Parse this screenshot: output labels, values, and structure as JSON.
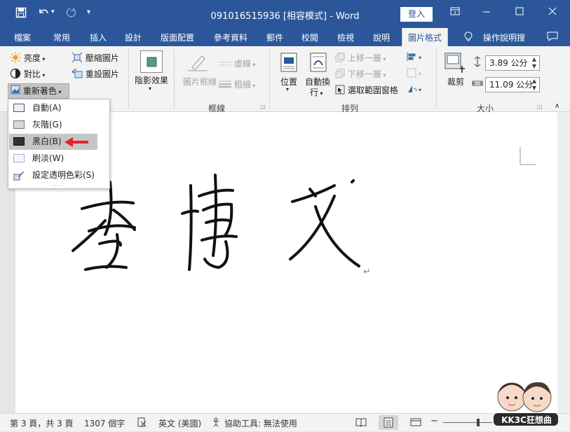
{
  "titlebar": {
    "title": "091016515936 [相容模式] - Word",
    "login": "登入",
    "icons": {
      "save": "save-icon",
      "undo": "undo-icon",
      "redo": "redo-icon",
      "customize": "customize-icon"
    }
  },
  "tabs": [
    "檔案",
    "常用",
    "插入",
    "設計",
    "版面配置",
    "參考資料",
    "郵件",
    "校閱",
    "檢視",
    "說明",
    "圖片格式",
    "操作說明搜"
  ],
  "active_tab": "圖片格式",
  "ribbon": {
    "adjust": {
      "brightness": "亮度",
      "contrast": "對比",
      "recolor": "重新著色",
      "compress": "壓縮圖片",
      "reset": "重設圖片"
    },
    "effects": {
      "shadow": "陰影效果"
    },
    "border": {
      "frame": "圖片框線",
      "dash": "虛線",
      "weight": "粗細",
      "group": "框線"
    },
    "arrange": {
      "position": "位置",
      "wrap_1": "自動換",
      "wrap_2": "行",
      "forward": "上移一層",
      "backward": "下移一層",
      "selection": "選取範圍窗格",
      "group": "排列"
    },
    "size": {
      "crop": "裁剪",
      "height": "3.89 公分",
      "width": "11.09 公分",
      "group": "大小"
    }
  },
  "recolor_menu": [
    {
      "label": "自動(A)",
      "key": "auto",
      "icon": "picture-auto-icon"
    },
    {
      "label": "灰階(G)",
      "key": "gray",
      "icon": "picture-gray-icon"
    },
    {
      "label": "黑白(B)",
      "key": "bw",
      "icon": "picture-bw-icon",
      "highlight": true
    },
    {
      "label": "刷淡(W)",
      "key": "wash",
      "icon": "picture-washout-icon"
    },
    {
      "label": "設定透明色彩(S)",
      "key": "transparent",
      "icon": "set-transparent-icon"
    }
  ],
  "document": {
    "signature_text": "李博文",
    "return_mark": "↵"
  },
  "statusbar": {
    "page": "第 3 頁，共 3 頁",
    "words": "1307 個字",
    "language": "英文 (美國)",
    "accessibility": "協助工具: 無法使用"
  },
  "watermark": "KK3C狂想曲",
  "colors": {
    "titlebar": "#2b579a",
    "ribbon": "#f3f3f3",
    "accent_arrow": "#e8202a"
  }
}
